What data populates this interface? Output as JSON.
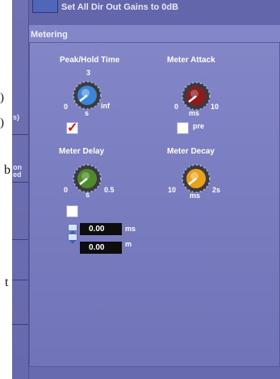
{
  "left_panel": {
    "line1_text": ")",
    "line2_text": ")",
    "s_label": "s)",
    "on_label": "on",
    "ed_label": "ed",
    "b_text": "b",
    "t_text": "t"
  },
  "topbar": {
    "text": "Set All Dir Out Gains to 0dB"
  },
  "metering": {
    "title": "Metering",
    "peak_hold": {
      "label": "Peak/Hold Time",
      "value": "3",
      "min": "0",
      "max": "inf",
      "unit": "s",
      "color": "#3d86d6"
    },
    "meter_attack": {
      "label": "Meter Attack",
      "min": "0",
      "max": "10",
      "unit": "ms",
      "color": "#8b1c1c"
    },
    "meter_delay": {
      "label": "Meter Delay",
      "min": "0",
      "max": "0.5",
      "unit": "s",
      "color": "#4f8a2a"
    },
    "meter_decay": {
      "label": "Meter Decay",
      "min": "10",
      "max": "2s",
      "unit": "ms",
      "color": "#e8a21a"
    },
    "pre_label": "pre",
    "delay_ms_value": "0.00",
    "delay_ms_unit": "ms",
    "delay_m_value": "0.00",
    "delay_m_unit": "m",
    "checkmark": "✓",
    "peak_hold_checked": true,
    "pre_checked": false,
    "delay_checked": false
  }
}
